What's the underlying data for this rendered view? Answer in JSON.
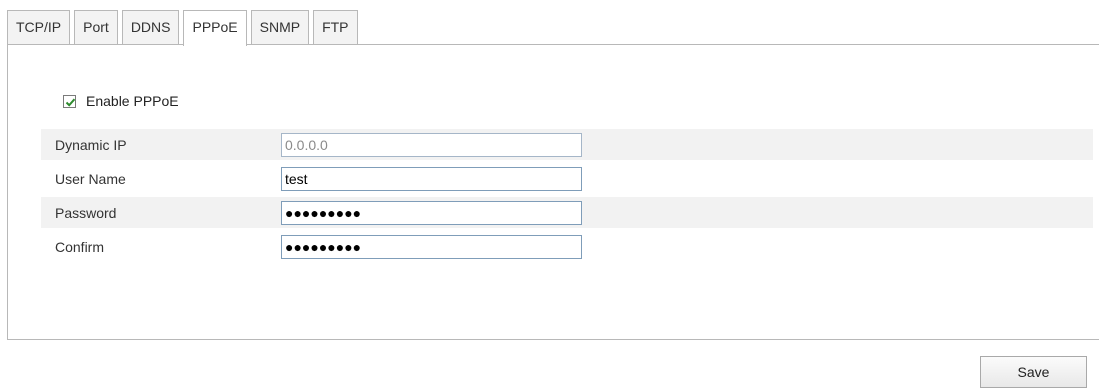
{
  "tabs": [
    {
      "label": "TCP/IP",
      "active": false
    },
    {
      "label": "Port",
      "active": false
    },
    {
      "label": "DDNS",
      "active": false
    },
    {
      "label": "PPPoE",
      "active": true
    },
    {
      "label": "SNMP",
      "active": false
    },
    {
      "label": "FTP",
      "active": false
    }
  ],
  "enable": {
    "label": "Enable PPPoE",
    "checked": true
  },
  "fields": {
    "dynamic_ip": {
      "label": "Dynamic IP",
      "value": "0.0.0.0"
    },
    "user_name": {
      "label": "User Name",
      "value": "test"
    },
    "password": {
      "label": "Password",
      "value": "●●●●●●●●●"
    },
    "confirm": {
      "label": "Confirm",
      "value": "●●●●●●●●●"
    }
  },
  "save_label": "Save",
  "colors": {
    "checkmark": "#2e8b2e",
    "field_border": "#7f9db9",
    "row_shade": "#f2f2f2"
  }
}
